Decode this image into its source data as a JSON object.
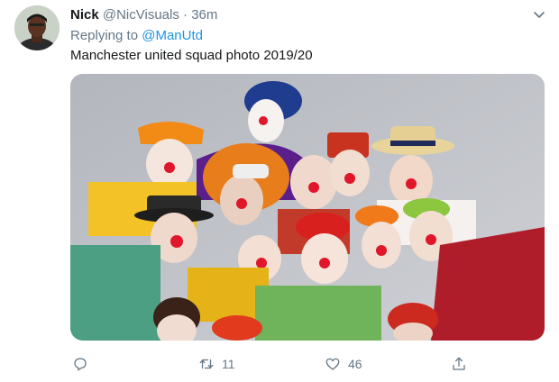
{
  "author": {
    "name": "Nick",
    "handle": "@NicVisuals",
    "separator": "·",
    "time": "36m"
  },
  "reply_context": {
    "prefix": "Replying to",
    "mention": "@ManUtd"
  },
  "tweet_text": "Manchester united squad photo 2019/20",
  "media": {
    "icon": "photo-of-group-of-clowns",
    "background_color": "#b9bcc3"
  },
  "actions": {
    "reply": {
      "icon": "reply-icon",
      "count": ""
    },
    "retweet": {
      "icon": "retweet-icon",
      "count": "11"
    },
    "like": {
      "icon": "heart-icon",
      "count": "46"
    },
    "share": {
      "icon": "share-icon",
      "count": ""
    }
  },
  "colors": {
    "link": "#1b95e0",
    "secondary_text": "#657786",
    "primary_text": "#14171a"
  }
}
